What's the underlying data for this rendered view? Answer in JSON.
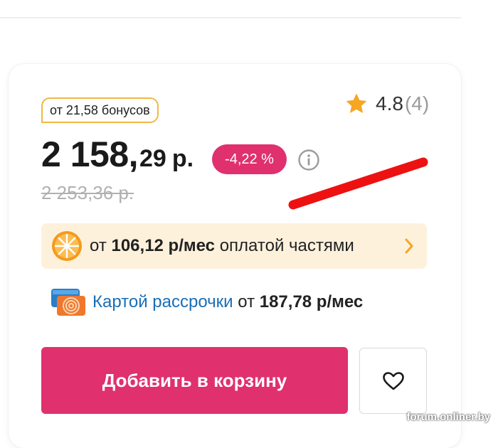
{
  "bonus": {
    "text": "от 21,58 бонусов"
  },
  "rating": {
    "value": "4.8",
    "count": "(4)",
    "icon": "star-icon",
    "star_color": "#f5a623"
  },
  "price": {
    "main": "2 158,",
    "cents": "29",
    "currency": "р.",
    "discount": "-4,22 %",
    "old": "2 253,36 р."
  },
  "installment": {
    "prefix": "от",
    "amount": "106,12 р/мес",
    "suffix": "оплатой частями",
    "icon": "orange-slice-icon"
  },
  "card_installment": {
    "link": "Картой рассрочки",
    "prefix": "от",
    "amount": "187,78 р/мес",
    "icon": "installment-card-icon"
  },
  "actions": {
    "add_to_cart": "Добавить в корзину",
    "favorite_icon": "heart-icon"
  },
  "watermark": "forum.onliner.by",
  "colors": {
    "accent": "#e0306e",
    "bonus_border": "#f2b844",
    "installment_bg": "#fdf1dc",
    "link": "#1a6eb5"
  }
}
